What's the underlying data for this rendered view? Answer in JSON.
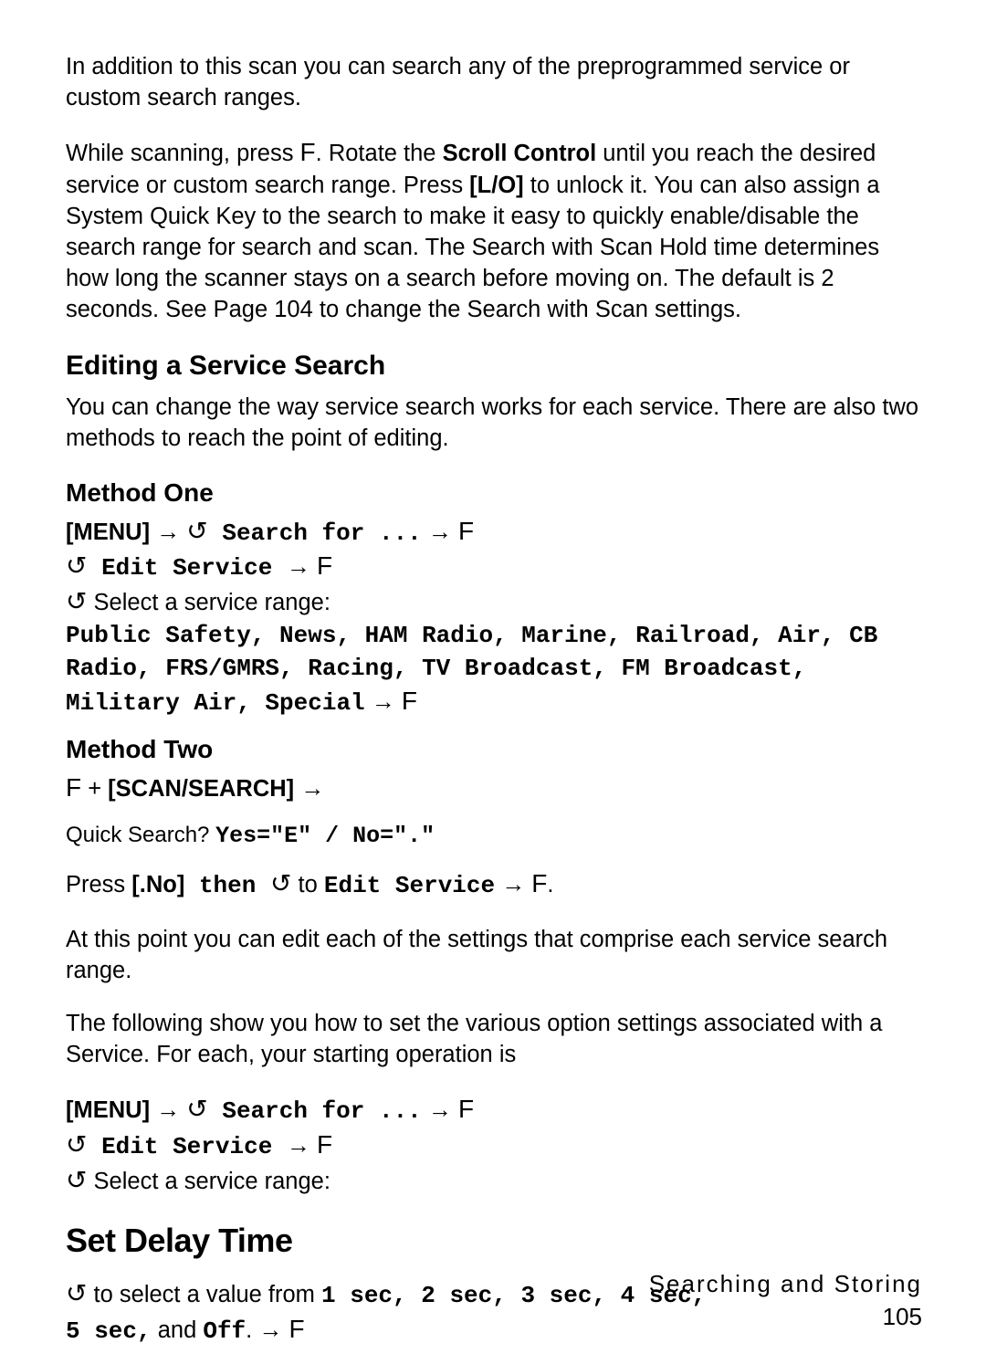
{
  "para1": "In addition to this scan you can search any of the preprogrammed service or custom search ranges.",
  "para2a": "While scanning, press ",
  "fkey": "F",
  "para2b": ". Rotate the ",
  "scrollControl": "Scroll Control",
  "para2c": " until you reach the desired service or custom search range. Press ",
  "lo": "[L/O]",
  "para2d": " to unlock it. You can also assign a System Quick Key to the search to make it easy to quickly enable/disable the search range for search and scan. The Search with Scan Hold time determines how long the scanner stays on a search before moving on. The default is 2 seconds. See Page 104 to change the Search with Scan settings.",
  "h3_editing": "Editing a Service Search",
  "para3": "You can change the way service search works for each service. There are also two methods to reach the point of editing.",
  "h4_method1": "Method One",
  "menu": "[MENU]",
  "arrow": "→",
  "scroll_icon": "↺",
  "mono_search_for": " Search for ...",
  "mono_edit_service": " Edit Service ",
  "select_range": " Select a service range:",
  "mono_services": "Public Safety, News, HAM Radio, Marine, Railroad, Air, CB Radio, FRS/GMRS, Racing, TV Broadcast, FM Broadcast, Military Air, Special",
  "h4_method2": "Method Two",
  "plus": " + ",
  "scan_search": "[SCAN/SEARCH]",
  "quick_search_label": "Quick Search? ",
  "quick_search_mono": "Yes=\"E\" / No=\".\"",
  "press": "Press ",
  "dotNo": "[.No]",
  "then_mono": " then ",
  "to_txt": " to ",
  "edit_service2": "Edit Service",
  "period": ".",
  "para4": "At this point you can edit each of the settings that comprise each service search range.",
  "para5": "The following show you how to set the various option settings associated with a Service. For each, your starting operation is",
  "h2_setdelay": "Set Delay Time",
  "delay_a": " to select a value from ",
  "delay_vals1": "1 sec, 2 sec, 3 sec, 4 sec,",
  "delay_vals2": "5 sec,",
  "and_txt": " and ",
  "off_mono": "Off",
  "footer_section": "Searching and Storing",
  "page_number": "105"
}
